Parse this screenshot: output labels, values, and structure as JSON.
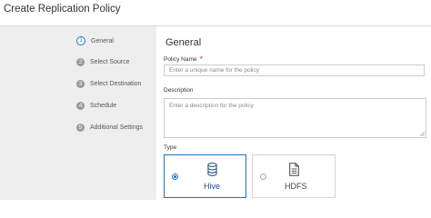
{
  "header": {
    "title": "Create Replication Policy"
  },
  "steps": [
    {
      "number": "1",
      "label": "General"
    },
    {
      "number": "2",
      "label": "Select Source"
    },
    {
      "number": "3",
      "label": "Select Destination"
    },
    {
      "number": "4",
      "label": "Schedule"
    },
    {
      "number": "5",
      "label": "Additional Settings"
    }
  ],
  "main": {
    "section_title": "General",
    "policy_name": {
      "label": "Policy Name",
      "required_mark": "*",
      "value": "",
      "placeholder": "Enter a unique name for the policy"
    },
    "description": {
      "label": "Description",
      "value": "",
      "placeholder": "Enter a description for the policy"
    },
    "type": {
      "label": "Type",
      "selected": "Hive",
      "options": [
        {
          "label": "Hive",
          "icon": "database-icon",
          "selected": true
        },
        {
          "label": "HDFS",
          "icon": "file-icon",
          "selected": false
        }
      ]
    }
  },
  "colors": {
    "accent": "#1a73c9",
    "sidebar_bg": "#eeeeee",
    "required": "#dd3333"
  }
}
